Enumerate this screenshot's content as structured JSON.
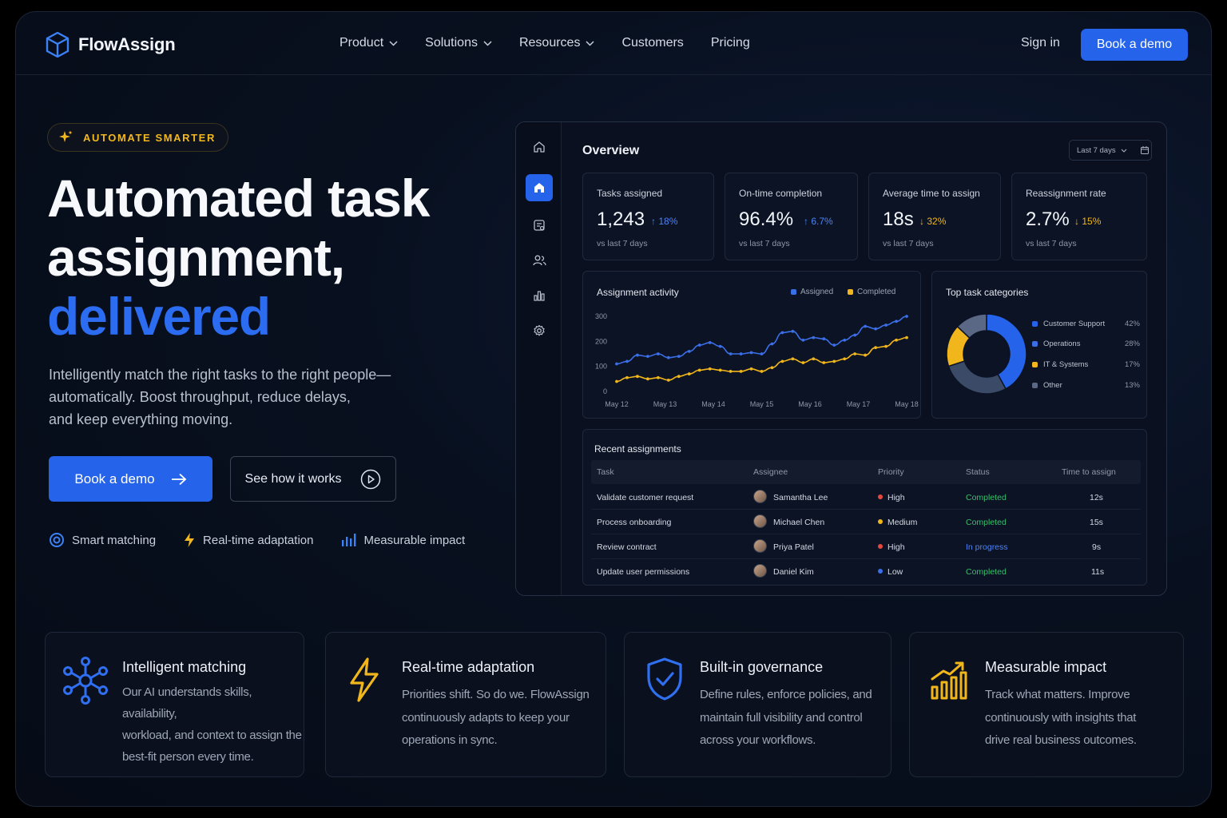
{
  "brand": {
    "name": "FlowAssign"
  },
  "nav": {
    "items": [
      {
        "label": "Product",
        "has_dropdown": true
      },
      {
        "label": "Solutions",
        "has_dropdown": true
      },
      {
        "label": "Resources",
        "has_dropdown": true
      },
      {
        "label": "Customers",
        "has_dropdown": false
      },
      {
        "label": "Pricing",
        "has_dropdown": false
      }
    ],
    "sign_in": "Sign in",
    "cta": "Book a demo"
  },
  "hero": {
    "badge": "AUTOMATE SMARTER",
    "headline_line1": "Automated task",
    "headline_line2": "assignment,",
    "headline_accent": "delivered",
    "subtitle_line1": "Intelligently match the right tasks to the right people—",
    "subtitle_line2": "automatically. Boost throughput, reduce delays,",
    "subtitle_line3": "and keep everything moving.",
    "primary_cta": "Book a demo",
    "secondary_cta": "See how it works",
    "highlights": [
      {
        "icon": "target-icon",
        "label": "Smart matching"
      },
      {
        "icon": "lightning-icon",
        "label": "Real-time adaptation"
      },
      {
        "icon": "bar-chart-icon",
        "label": "Measurable impact"
      }
    ]
  },
  "dashboard": {
    "title": "Overview",
    "date_range": "Last 7 days",
    "sidebar_icons": [
      "home-outline-icon",
      "home-icon",
      "tasks-icon",
      "users-icon",
      "analytics-icon",
      "settings-icon"
    ],
    "stats": [
      {
        "label": "Tasks assigned",
        "value": "1,243",
        "delta": "18%",
        "direction": "up",
        "foot": "vs last 7 days"
      },
      {
        "label": "On-time completion",
        "value": "96.4%",
        "delta": "6.7%",
        "direction": "up",
        "foot": "vs last 7 days"
      },
      {
        "label": "Average time to assign",
        "value": "18s",
        "delta": "32%",
        "direction": "down",
        "foot": "vs last 7 days"
      },
      {
        "label": "Reassignment rate",
        "value": "2.7%",
        "delta": "15%",
        "direction": "down",
        "foot": "vs last 7 days"
      }
    ],
    "activity_title": "Assignment activity",
    "categories_title": "Top task categories",
    "recent": {
      "title": "Recent assignments",
      "columns": [
        "Task",
        "Assignee",
        "Priority",
        "Status",
        "Time to assign"
      ],
      "rows": [
        {
          "task": "Validate customer request",
          "assignee": "Samantha Lee",
          "priority": "High",
          "status": "Completed",
          "time": "12s"
        },
        {
          "task": "Process onboarding",
          "assignee": "Michael Chen",
          "priority": "Medium",
          "status": "Completed",
          "time": "15s"
        },
        {
          "task": "Review contract",
          "assignee": "Priya Patel",
          "priority": "High",
          "status": "In progress",
          "time": "9s"
        },
        {
          "task": "Update user permissions",
          "assignee": "Daniel Kim",
          "priority": "Low",
          "status": "Completed",
          "time": "11s"
        }
      ]
    }
  },
  "colors": {
    "accent": "#2563eb",
    "assigned": "#3b6fe8",
    "completed": "#f0b61c",
    "up": "#4f83f5",
    "down": "#f0b61c",
    "priority_high": "#e5483f",
    "priority_medium": "#f0b61c",
    "priority_low": "#3b6fe8",
    "status_completed": "#38c06b",
    "status_in_progress": "#4f83f5"
  },
  "chart_data": [
    {
      "type": "line",
      "title": "Assignment activity",
      "x": [
        "May 12",
        "",
        "",
        "",
        "May 13",
        "",
        "",
        "",
        "May 14",
        "",
        "",
        "",
        "May 15",
        "",
        "",
        "",
        "May 16",
        "",
        "",
        "",
        "May 17",
        "",
        "",
        "",
        "May 18"
      ],
      "x_ticks": [
        "May 12",
        "May 13",
        "May 14",
        "May 15",
        "May 16",
        "May 17",
        "May 18"
      ],
      "ylim": [
        0,
        300
      ],
      "y_ticks": [
        0,
        100,
        200,
        300
      ],
      "legend": "top-right",
      "series": [
        {
          "name": "Assigned",
          "color": "#3b6fe8",
          "values": [
            110,
            120,
            145,
            140,
            150,
            135,
            140,
            160,
            185,
            195,
            180,
            150,
            150,
            155,
            150,
            190,
            235,
            240,
            205,
            215,
            210,
            185,
            205,
            225,
            260,
            250,
            265,
            280,
            300
          ]
        },
        {
          "name": "Completed",
          "color": "#f0b61c",
          "values": [
            40,
            55,
            60,
            50,
            55,
            45,
            60,
            70,
            85,
            90,
            85,
            80,
            80,
            90,
            80,
            95,
            120,
            130,
            115,
            130,
            115,
            120,
            130,
            150,
            145,
            175,
            180,
            205,
            215
          ]
        }
      ]
    },
    {
      "type": "pie",
      "title": "Top task categories",
      "categories": [
        "Customer Support",
        "Operations",
        "IT & Systems",
        "Other"
      ],
      "values": [
        42,
        28,
        17,
        13
      ],
      "labels": [
        "42%",
        "28%",
        "17%",
        "13%"
      ],
      "colors": [
        "#2563eb",
        "#3b4a66",
        "#f0b61c",
        "#5a6785"
      ]
    }
  ],
  "features": [
    {
      "icon": "network-icon",
      "title": "Intelligent matching",
      "body": [
        "Our AI understands skills, availability,",
        "workload, and context to assign the",
        "best-fit person every time."
      ]
    },
    {
      "icon": "lightning-icon",
      "title": "Real-time adaptation",
      "body": [
        "Priorities shift. So do we. FlowAssign",
        "continuously adapts to keep your",
        "operations in sync."
      ]
    },
    {
      "icon": "shield-check-icon",
      "title": "Built-in governance",
      "body": [
        "Define rules, enforce policies, and",
        "maintain full visibility and control",
        "across your workflows."
      ]
    },
    {
      "icon": "growth-chart-icon",
      "title": "Measurable impact",
      "body": [
        "Track what matters. Improve",
        "continuously with insights that",
        "drive real business outcomes."
      ]
    }
  ]
}
